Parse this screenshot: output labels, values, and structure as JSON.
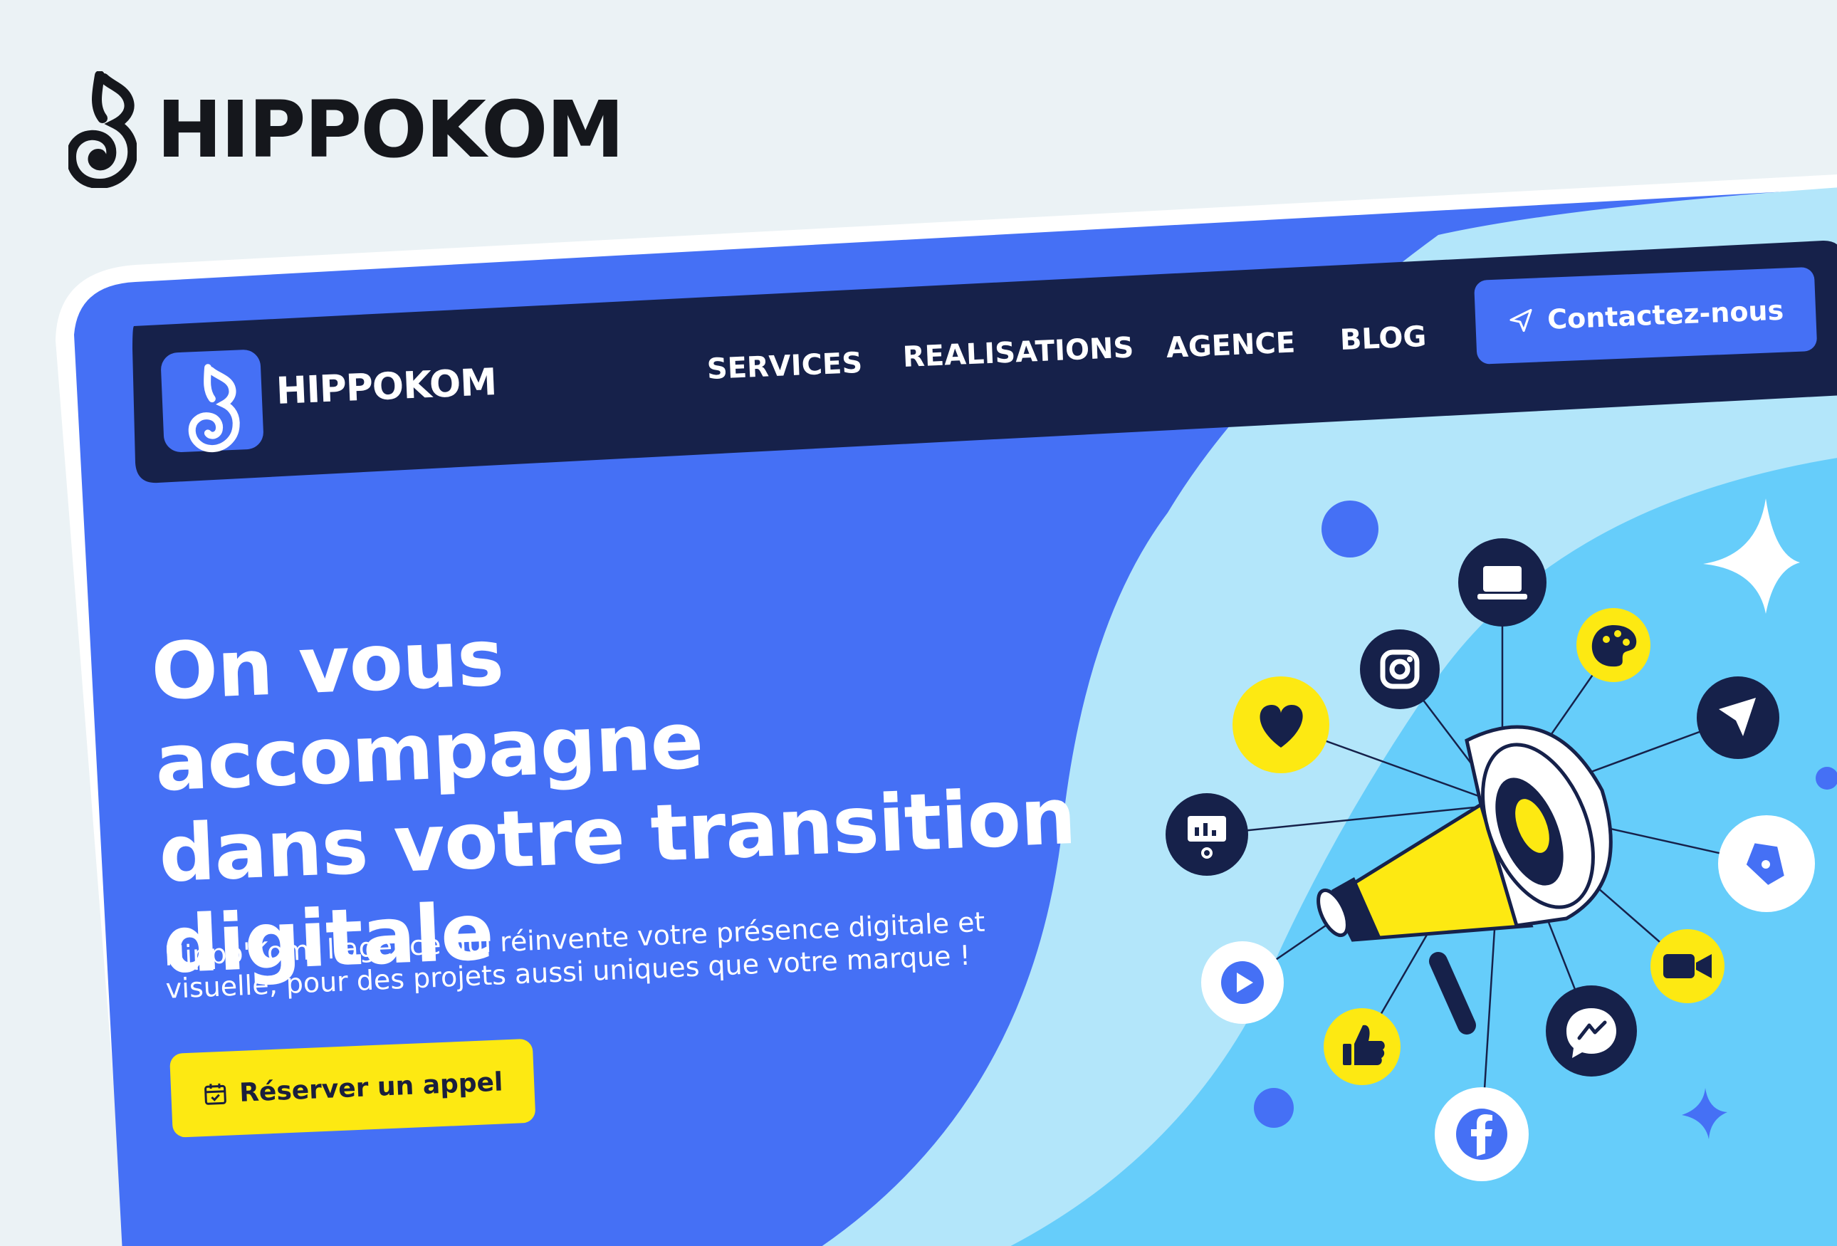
{
  "brand": {
    "name": "HIPPOKOM"
  },
  "nav": {
    "logo_text": "HIPPOKOM",
    "items": [
      "SERVICES",
      "REALISATIONS",
      "AGENCE",
      "BLOG"
    ],
    "cta": "Contactez-nous"
  },
  "hero": {
    "title_lines": [
      "On vous accompagne",
      "dans votre transition",
      "digitale"
    ],
    "subtitle_lines": [
      "Hippô'Kom, l'agence qui réinvente votre présence digitale et",
      "visuelle, pour des projets aussi uniques que votre marque !"
    ],
    "button": "Réserver un appel"
  },
  "colors": {
    "page_bg": "#ebf2f5",
    "primary_blue": "#4570f5",
    "navy": "#16214a",
    "light_blue": "#b3e6fa",
    "sky_blue": "#66cdfa",
    "yellow": "#fde912"
  },
  "icons": {
    "hub": "megaphone-icon",
    "bubbles": [
      "laptop-icon",
      "instagram-icon",
      "palette-icon",
      "heart-icon",
      "send-icon",
      "presentation-icon",
      "pen-nib-icon",
      "play-icon",
      "video-camera-icon",
      "messenger-icon",
      "thumbs-up-icon",
      "facebook-icon"
    ]
  }
}
